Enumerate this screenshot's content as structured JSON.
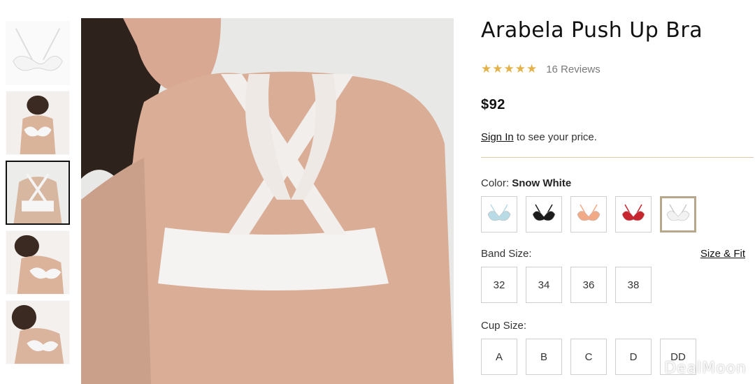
{
  "product": {
    "title": "Arabela Push Up Bra",
    "stars": "★★★★★",
    "reviews": "16 Reviews",
    "price": "$92",
    "signin_link": "Sign In",
    "signin_text": " to see your price."
  },
  "color": {
    "label": "Color: ",
    "selected": "Snow White",
    "swatches": [
      {
        "name": "light-blue",
        "hex": "#b9dbe6"
      },
      {
        "name": "black",
        "hex": "#1c1c1c"
      },
      {
        "name": "peach",
        "hex": "#f2a986"
      },
      {
        "name": "red",
        "hex": "#c8262e"
      },
      {
        "name": "snow-white",
        "hex": "#f2f2f2"
      }
    ]
  },
  "band": {
    "label": "Band Size:",
    "size_fit_link": "Size & Fit",
    "sizes": [
      "32",
      "34",
      "36",
      "38"
    ]
  },
  "cup": {
    "label": "Cup Size:",
    "sizes": [
      "A",
      "B",
      "C",
      "D",
      "DD"
    ]
  },
  "watermark": "DealMoon"
}
